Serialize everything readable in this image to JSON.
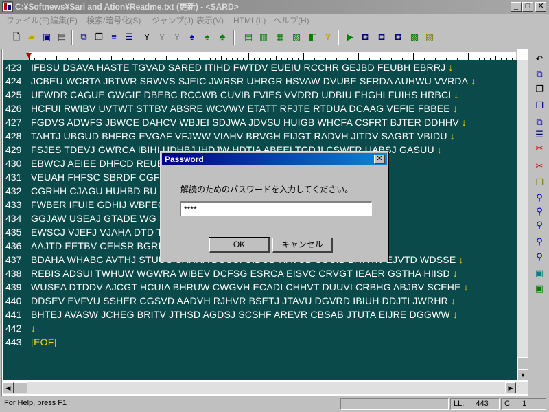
{
  "window": {
    "title": "C:¥Softnews¥Sari and Ation¥Readme.txt (更新)  -  <SARD>",
    "min_label": "_",
    "max_label": "□",
    "close_label": "✕"
  },
  "menu": [
    "ファイル(F)",
    "編集(E)",
    "検索/暗号化(S)",
    "ジャンプ(J)",
    "表示(V)",
    "HTML(L)",
    "ヘルプ(H)"
  ],
  "editor": {
    "eof_marker": "[EOF]",
    "line_feed_symbol": "↓",
    "lines": [
      {
        "num": "423",
        "text": "IFBSU DSAVA HASTE TGVAD SARED ITIHD FWTDV EUEIU RCCHR GEJBD FEUBH EBRRJ"
      },
      {
        "num": "424",
        "text": "JCBEU WCRTA JBTWR SRWVS SJEIC JWRSR UHRGR HSVAW DVUBE SFRDA AUHWU VVRDA"
      },
      {
        "num": "425",
        "text": "UFWDR CAGUE GWGIF DBEBC RCCWB CUVIB FVIES VVDRD UDBIU FHGHI FUIHS HRBCI"
      },
      {
        "num": "426",
        "text": "HCFUI RWIBV UVTWT STTBV ABSRE WCVWV ETATT RFJTE RTDUA DCAAG VEFIE FBBEE"
      },
      {
        "num": "427",
        "text": "FGDVS ADWFS JBWCE DAHCV WBJEI SDJWA JDVSU HUIGB WHCFA CSFRT BJTER DDHHV"
      },
      {
        "num": "428",
        "text": "TAHTJ UBGUD BHFRG EVGAF VFJWW VIAHV BRVGH EIJGT RADVH JITDV SAGBT VBIDU"
      },
      {
        "num": "429",
        "text": "FSJES TDEVJ GWRCA IBIHI UDHBJ IHDJW HDTIA ABEEI TGDJI CSWFR UABSJ GASUU"
      },
      {
        "num": "430",
        "text": "EBWCJ AEIEE DHFCD REUBI                                      UFFE DWJWR"
      },
      {
        "num": "431",
        "text": "VEUAH FHFSC SBRDF CGFC                                  TWASW CHTHE"
      },
      {
        "num": "432",
        "text": "CGRHH CJAGU HUHBD BU                                    BUA RUWSS IBFSW"
      },
      {
        "num": "433",
        "text": "FWBER IFUIE GDHIJ WBFEG                                   GSJB GARII"
      },
      {
        "num": "434",
        "text": "GGJAW USEAJ GTADE WG                                    SA FVEJA VRGBG"
      },
      {
        "num": "435",
        "text": "EWSCJ VJEFJ VJAHA DTD                                    TUVSR WCEUI"
      },
      {
        "num": "436",
        "text": "AAJTD EETBV CEHSR BGRH                                    FVWI UFREW"
      },
      {
        "num": "437",
        "text": "BDAHA WHABC AVTHJ STUUC SAHHA DUUSI UIDUD HAVUD SUCIB BAVHW EJVTD WDSSE"
      },
      {
        "num": "438",
        "text": "REBIS ADSUI TWHUW WGWRA WIBEV DCFSG ESRCA EISVC CRVGT IEAER GSTHA HIISD"
      },
      {
        "num": "439",
        "text": "WUSEA DTDDV AJCGT HCUIA BHRUW CWGVH ECADI CHHVT DUUVI CRBHG ABJBV SCEHE"
      },
      {
        "num": "440",
        "text": "DDSEV EVFVU SSHER CGSVD AADVH RJHVR BSETJ JTAVU DGVRD IBIUH DDJTI JWRHR"
      },
      {
        "num": "441",
        "text": "BHTEJ AVASW JCHEG BRITV JTHSD AGDSJ SCSHF AREVR CBSAB JTUTA EIJRE DGGWW"
      },
      {
        "num": "442",
        "text": ""
      },
      {
        "num": "443",
        "text": ""
      }
    ]
  },
  "toolbar_icons": [
    "new-file-icon",
    "open-folder-icon",
    "save-icon",
    "print-icon",
    "cut-icon",
    "copy-icon",
    "paste-icon",
    "align-icon",
    "sort-icon",
    "filter-icon",
    "tool-a-icon",
    "tool-b-icon",
    "tool-c-icon",
    "tool-d-icon",
    "tool-e-icon",
    "view-1-icon",
    "view-2-icon",
    "view-3-icon",
    "view-4-icon",
    "help-icon",
    "run-icon",
    "html-1-icon",
    "html-2-icon",
    "html-3-icon",
    "html-4-icon",
    "html-5-icon"
  ],
  "right_toolbar_icons": [
    "undo-icon",
    "clipboard-1-icon",
    "clipboard-2-icon",
    "clipboard-3-icon",
    "clipboard-4-icon",
    "list-icon",
    "cut-red-icon",
    "scissors-icon",
    "clipboard-5-icon",
    "find-icon",
    "find-next-icon",
    "find-prev-icon",
    "replace-icon",
    "search-file-icon",
    "tool-r1-icon",
    "tool-r2-icon"
  ],
  "dialog": {
    "title": "Password",
    "prompt": "解読のためのパスワードを入力してください。",
    "password_value": "****",
    "ok_label": "OK",
    "cancel_label": "キャンセル",
    "close_label": "✕"
  },
  "status": {
    "help_text": "For Help, press F1",
    "line_label": "LL:",
    "line_value": "443",
    "col_label": "C:",
    "col_value": "1"
  }
}
